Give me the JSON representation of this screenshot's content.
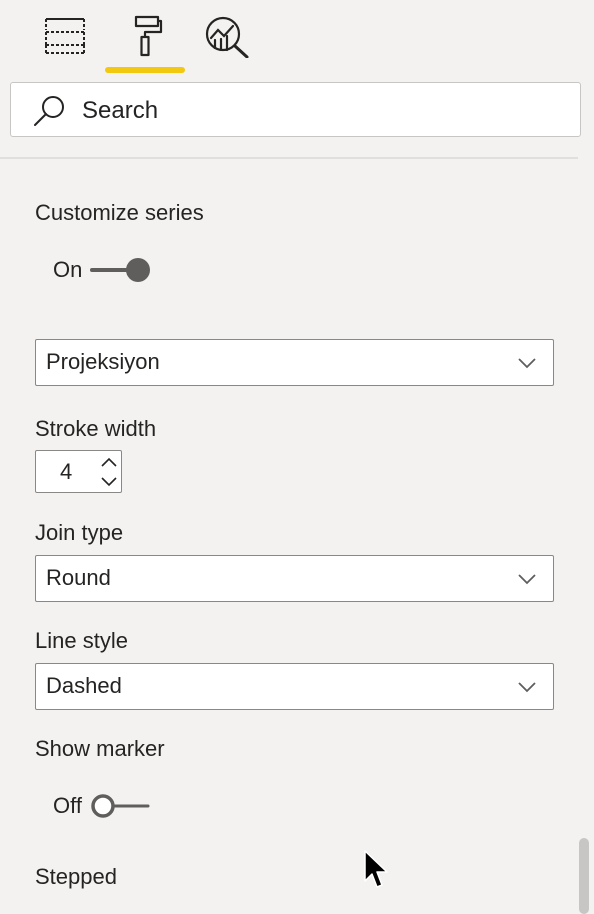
{
  "tabs": [
    {
      "name": "fields",
      "icon": "fields-table-icon"
    },
    {
      "name": "format",
      "icon": "paint-roller-icon"
    },
    {
      "name": "analytics",
      "icon": "analytics-magnifier-icon"
    }
  ],
  "active_tab": "format",
  "colors": {
    "accent": "#f2c811",
    "panel_bg": "#f3f2f1",
    "toggle_on": "#605e5c",
    "border": "#8a8886"
  },
  "search": {
    "placeholder": "Search"
  },
  "customize_series": {
    "label": "Customize series",
    "toggle_label": "On",
    "state": true
  },
  "series_dropdown": {
    "value": "Projeksiyon"
  },
  "stroke_width": {
    "label": "Stroke width",
    "value": "4"
  },
  "join_type": {
    "label": "Join type",
    "value": "Round"
  },
  "line_style": {
    "label": "Line style",
    "value": "Dashed"
  },
  "show_marker": {
    "label": "Show marker",
    "toggle_label": "Off",
    "state": false
  },
  "stepped": {
    "label": "Stepped"
  }
}
